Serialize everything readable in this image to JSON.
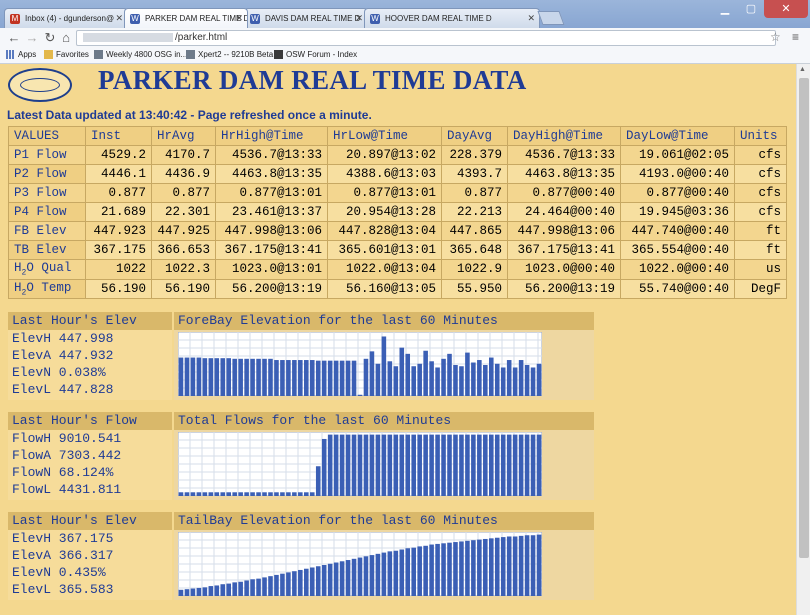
{
  "browser": {
    "tabs": [
      {
        "label": "Inbox (4) - dgunderson@",
        "favicon": "M",
        "favicon_color": "#c23321"
      },
      {
        "label": "PARKER DAM REAL TIME D",
        "favicon": "W",
        "favicon_color": "#3f5fae"
      },
      {
        "label": "DAVIS DAM REAL TIME D",
        "favicon": "W",
        "favicon_color": "#3f5fae"
      },
      {
        "label": "HOOVER DAM REAL TIME D",
        "favicon": "W",
        "favicon_color": "#3f5fae"
      }
    ],
    "url_path": "/parker.html",
    "bookmarks": [
      "Apps",
      "Favorites",
      "Weekly 4800 OSG in...",
      "Xpert2 -- 9210B Beta ...",
      "OSW Forum - Index"
    ]
  },
  "page": {
    "title": "PARKER DAM REAL TIME DATA",
    "updated": "Latest Data updated at 13:40:42 - Page refreshed once a minute."
  },
  "table": {
    "headers": [
      "VALUES",
      "Inst",
      "HrAvg",
      "HrHigh@Time",
      "HrLow@Time",
      "DayAvg",
      "DayHigh@Time",
      "DayLow@Time",
      "Units"
    ],
    "rows": [
      {
        "label": "P1 Flow",
        "cells": [
          "4529.2",
          "4170.7",
          "4536.7@13:33",
          "20.897@13:02",
          "228.379",
          "4536.7@13:33",
          "19.061@02:05",
          "cfs"
        ]
      },
      {
        "label": "P2 Flow",
        "cells": [
          "4446.1",
          "4436.9",
          "4463.8@13:35",
          "4388.6@13:03",
          "4393.7",
          "4463.8@13:35",
          "4193.0@00:40",
          "cfs"
        ]
      },
      {
        "label": "P3 Flow",
        "cells": [
          "0.877",
          "0.877",
          "0.877@13:01",
          "0.877@13:01",
          "0.877",
          "0.877@00:40",
          "0.877@00:40",
          "cfs"
        ]
      },
      {
        "label": "P4 Flow",
        "cells": [
          "21.689",
          "22.301",
          "23.461@13:37",
          "20.954@13:28",
          "22.213",
          "24.464@00:40",
          "19.945@03:36",
          "cfs"
        ]
      },
      {
        "label": "FB Elev",
        "cells": [
          "447.923",
          "447.925",
          "447.998@13:06",
          "447.828@13:04",
          "447.865",
          "447.998@13:06",
          "447.740@00:40",
          "ft"
        ]
      },
      {
        "label": "TB Elev",
        "cells": [
          "367.175",
          "366.653",
          "367.175@13:41",
          "365.601@13:01",
          "365.648",
          "367.175@13:41",
          "365.554@00:40",
          "ft"
        ]
      },
      {
        "label_pre": "H",
        "label_sub": "2",
        "label_post": "O Qual",
        "cells": [
          "1022",
          "1022.3",
          "1023.0@13:01",
          "1022.0@13:04",
          "1022.9",
          "1023.0@00:40",
          "1022.0@00:40",
          "us"
        ]
      },
      {
        "label_pre": "H",
        "label_sub": "2",
        "label_post": "O Temp",
        "cells": [
          "56.190",
          "56.190",
          "56.200@13:19",
          "56.160@13:05",
          "55.950",
          "56.200@13:19",
          "55.740@00:40",
          "DegF"
        ]
      }
    ]
  },
  "panels": [
    {
      "left_title": "Last Hour's Elev",
      "right_title": "ForeBay Elevation for the last 60 Minutes",
      "stats": [
        "ElevH 447.998",
        "ElevA 447.932",
        "ElevN 0.038%",
        "ElevL 447.828"
      ],
      "bar_color": "#3b5fb5",
      "values": [
        0.62,
        0.62,
        0.62,
        0.62,
        0.61,
        0.61,
        0.61,
        0.61,
        0.61,
        0.6,
        0.6,
        0.6,
        0.6,
        0.6,
        0.6,
        0.6,
        0.58,
        0.58,
        0.58,
        0.58,
        0.58,
        0.58,
        0.58,
        0.57,
        0.57,
        0.57,
        0.57,
        0.57,
        0.57,
        0.57,
        0.02,
        0.6,
        0.72,
        0.52,
        0.96,
        0.56,
        0.48,
        0.78,
        0.68,
        0.48,
        0.52,
        0.73,
        0.56,
        0.46,
        0.6,
        0.68,
        0.5,
        0.48,
        0.7,
        0.54,
        0.58,
        0.5,
        0.62,
        0.52,
        0.46,
        0.58,
        0.46,
        0.58,
        0.5,
        0.46,
        0.52
      ]
    },
    {
      "left_title": "Last Hour's Flow",
      "right_title": "Total Flows for the last 60 Minutes",
      "stats": [
        "FlowH 9010.541",
        "FlowA 7303.442",
        "FlowN 68.124%",
        "FlowL 4431.811"
      ],
      "bar_color": "#3b5fb5",
      "values": [
        0.06,
        0.06,
        0.06,
        0.06,
        0.06,
        0.06,
        0.06,
        0.06,
        0.06,
        0.06,
        0.06,
        0.06,
        0.06,
        0.06,
        0.06,
        0.06,
        0.06,
        0.06,
        0.06,
        0.06,
        0.06,
        0.06,
        0.06,
        0.48,
        0.92,
        0.99,
        0.99,
        0.99,
        0.99,
        0.99,
        0.99,
        0.99,
        0.99,
        0.99,
        0.99,
        0.99,
        0.99,
        0.99,
        0.99,
        0.99,
        0.99,
        0.99,
        0.99,
        0.99,
        0.99,
        0.99,
        0.99,
        0.99,
        0.99,
        0.99,
        0.99,
        0.99,
        0.99,
        0.99,
        0.99,
        0.99,
        0.99,
        0.99,
        0.99,
        0.99,
        0.99
      ]
    },
    {
      "left_title": "Last Hour's Elev",
      "right_title": "TailBay Elevation for the last 60 Minutes",
      "stats": [
        "ElevH 367.175",
        "ElevA 366.317",
        "ElevN 0.435%",
        "ElevL 365.583"
      ],
      "bar_color": "#3b5fb5",
      "values": [
        0.1,
        0.11,
        0.12,
        0.13,
        0.14,
        0.16,
        0.17,
        0.19,
        0.2,
        0.22,
        0.23,
        0.25,
        0.27,
        0.28,
        0.3,
        0.32,
        0.34,
        0.36,
        0.38,
        0.4,
        0.42,
        0.44,
        0.46,
        0.48,
        0.5,
        0.52,
        0.54,
        0.56,
        0.58,
        0.6,
        0.62,
        0.64,
        0.66,
        0.68,
        0.7,
        0.72,
        0.73,
        0.75,
        0.77,
        0.78,
        0.8,
        0.81,
        0.83,
        0.84,
        0.85,
        0.86,
        0.87,
        0.88,
        0.89,
        0.9,
        0.91,
        0.92,
        0.93,
        0.94,
        0.95,
        0.96,
        0.96,
        0.97,
        0.98,
        0.98,
        0.99
      ]
    }
  ]
}
